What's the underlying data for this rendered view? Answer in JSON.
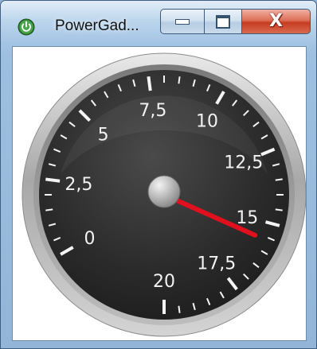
{
  "window": {
    "title": "PowerGad...",
    "app_icon": "power-icon",
    "buttons": {
      "minimize_icon": "minimize-icon",
      "maximize_icon": "maximize-icon",
      "close_glyph": "X"
    }
  },
  "gauge": {
    "min": 0,
    "max": 20,
    "value": 15.6,
    "labels": [
      "0",
      "2,5",
      "5",
      "7,5",
      "10",
      "12,5",
      "15",
      "17,5",
      "20"
    ],
    "needle_color": "#e0101e",
    "face_color": "#2b2b2b"
  }
}
